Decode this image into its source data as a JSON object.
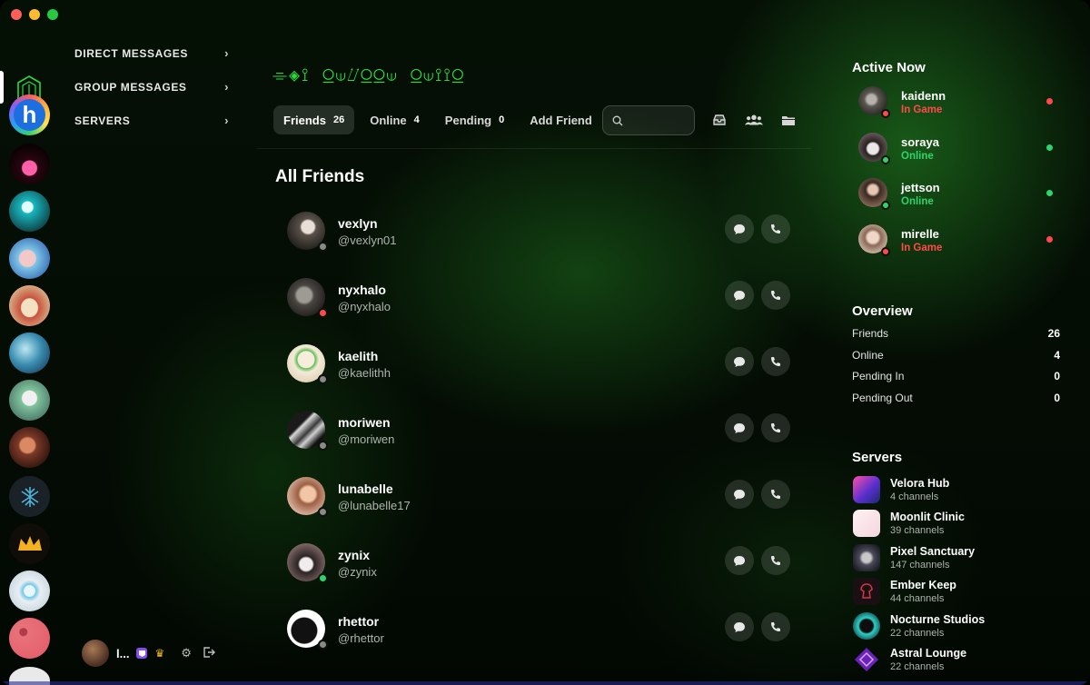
{
  "window": {
    "title_glyphs": "⌯◈⟟ ⍜⟒⌰⍜⍜⟒ ⍜⟒⟟⟟⍜"
  },
  "nav": {
    "items": [
      {
        "label": "DIRECT MESSAGES"
      },
      {
        "label": "GROUP MESSAGES"
      },
      {
        "label": "SERVERS"
      }
    ]
  },
  "user": {
    "name": "l..."
  },
  "tabs": [
    {
      "label": "Friends",
      "count": "26"
    },
    {
      "label": "Online",
      "count": "4"
    },
    {
      "label": "Pending",
      "count": "0"
    },
    {
      "label": "Add Friend",
      "count": ""
    }
  ],
  "search": {
    "placeholder": "",
    "value": ""
  },
  "section_title": "All Friends",
  "friends": [
    {
      "name": "vexlyn",
      "handle": "@vexlyn01",
      "status": "offline"
    },
    {
      "name": "nyxhalo",
      "handle": "@nyxhalo",
      "status": "busy"
    },
    {
      "name": "kaelith",
      "handle": "@kaelithh",
      "status": "offline"
    },
    {
      "name": "moriwen",
      "handle": "@moriwen",
      "status": "offline"
    },
    {
      "name": "lunabelle",
      "handle": "@lunabelle17",
      "status": "offline"
    },
    {
      "name": "zynix",
      "handle": "@zynix",
      "status": "online"
    },
    {
      "name": "rhettor",
      "handle": "@rhettor",
      "status": "offline"
    }
  ],
  "active_now": {
    "title": "Active Now",
    "users": [
      {
        "name": "kaidenn",
        "status": "In Game",
        "color": "#ff4a4a"
      },
      {
        "name": "soraya",
        "status": "Online",
        "color": "#2fd36b"
      },
      {
        "name": "jettson",
        "status": "Online",
        "color": "#2fd36b"
      },
      {
        "name": "mirelle",
        "status": "In Game",
        "color": "#ff4a4a"
      }
    ]
  },
  "overview": {
    "title": "Overview",
    "rows": [
      {
        "label": "Friends",
        "value": "26"
      },
      {
        "label": "Online",
        "value": "4"
      },
      {
        "label": "Pending In",
        "value": "0"
      },
      {
        "label": "Pending Out",
        "value": "0"
      }
    ]
  },
  "servers": {
    "title": "Servers",
    "items": [
      {
        "name": "Velora Hub",
        "channels": "4 channels"
      },
      {
        "name": "Moonlit Clinic",
        "channels": "39 channels"
      },
      {
        "name": "Pixel Sanctuary",
        "channels": "147 channels"
      },
      {
        "name": "Ember Keep",
        "channels": "44 channels"
      },
      {
        "name": "Nocturne Studios",
        "channels": "22 channels"
      },
      {
        "name": "Astral Lounge",
        "channels": "22 channels"
      }
    ]
  },
  "colors": {
    "online": "#2fd36b",
    "busy": "#ff4a4a",
    "offline": "#8a8a8a",
    "accent_green": "#2bdb3a"
  }
}
